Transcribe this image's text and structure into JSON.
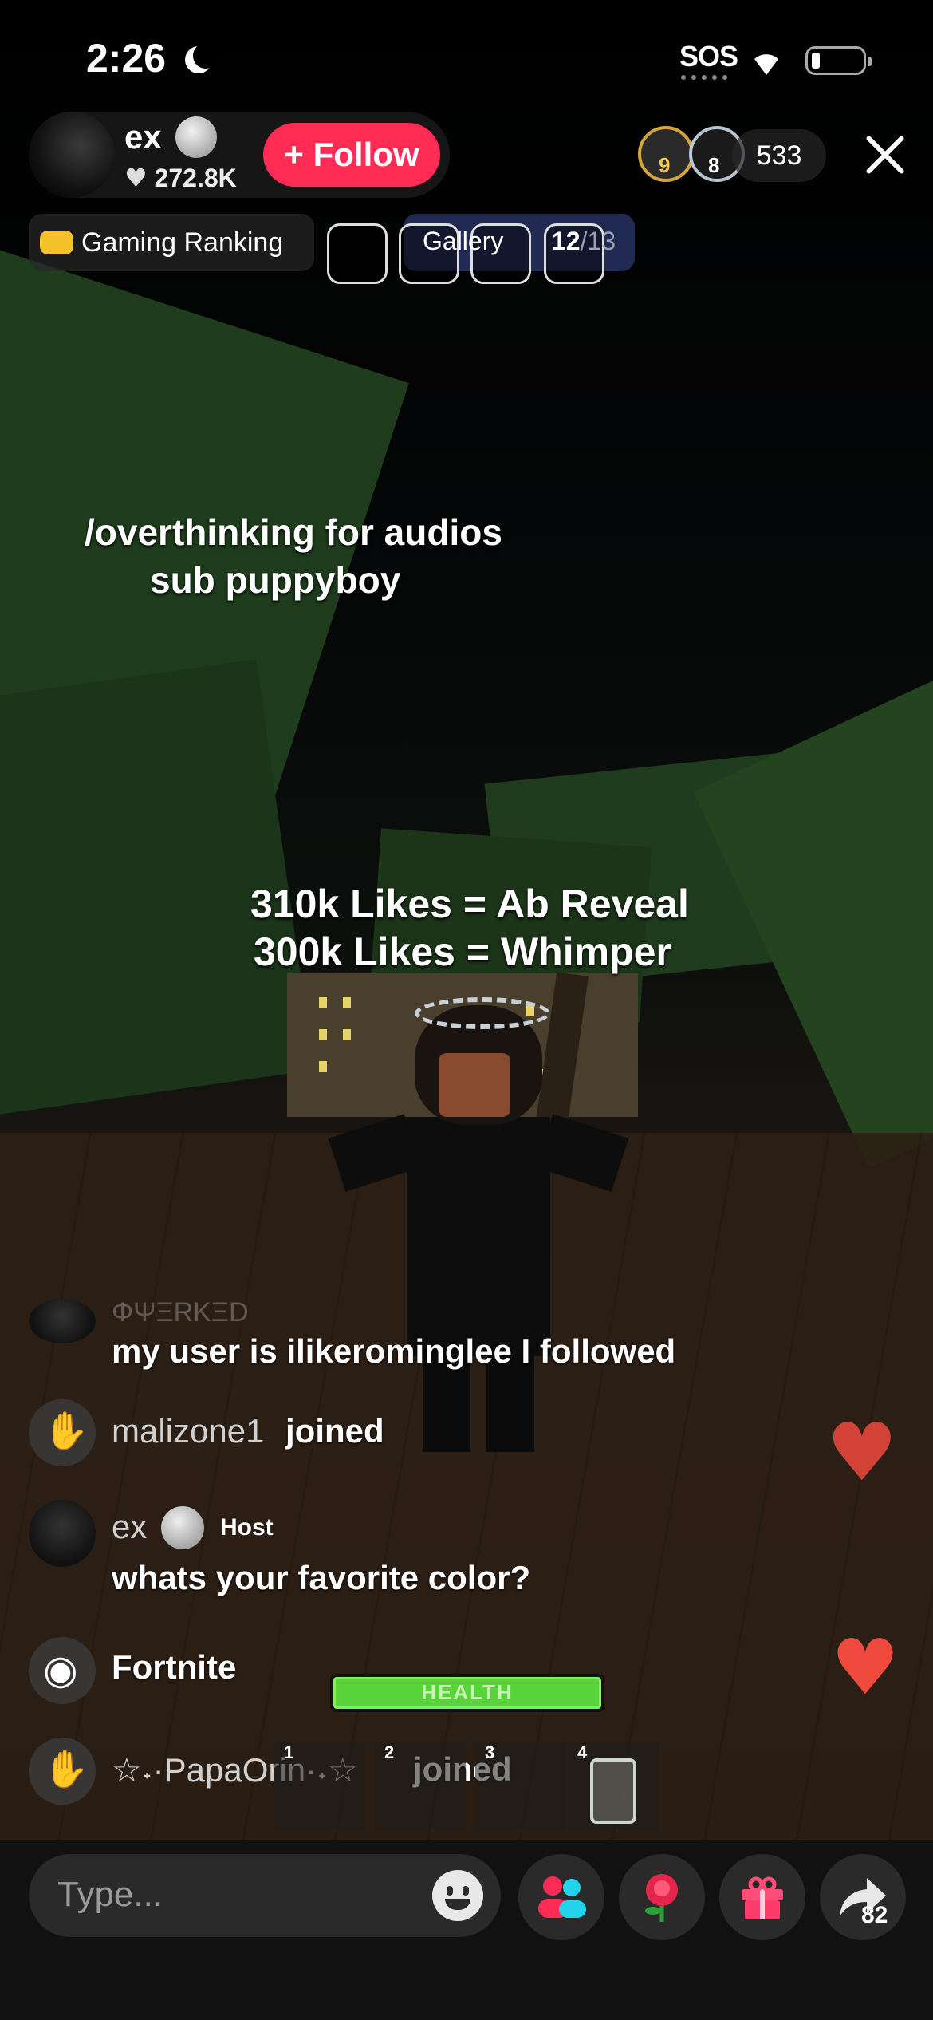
{
  "status_bar": {
    "time": "2:26",
    "sos": "SOS"
  },
  "host": {
    "name": "ex",
    "likes": "272.8K",
    "follow_label": "+ Follow"
  },
  "viewers": {
    "badge1_rank": "9",
    "badge2_rank": "8",
    "count": "533"
  },
  "top_row": {
    "ranking_label": "Gaming Ranking",
    "gallery_label": "Gallery",
    "gallery_current": "12",
    "gallery_total": "/13"
  },
  "stream_overlay": {
    "line1": "/overthinking for audios",
    "line2": "sub puppyboy",
    "line3": "310k Likes = Ab Reveal",
    "line4": "300k Likes = Whimper"
  },
  "comments": {
    "faded_name": "ΦΨΞRΚΞD",
    "c1_text": "my user is ilikerominglee I followed",
    "c2_name": "malizone1",
    "c2_text": "joined",
    "c3_name": "ex",
    "c3_tag": "Host",
    "c3_text": "whats your favorite color?",
    "c4_text": "Fortnite",
    "c5_name": "☆˖·PapaOrin·˖☆",
    "c5_text": "joined"
  },
  "game_hud": {
    "health_label": "HEALTH",
    "slots": [
      "1",
      "2",
      "3",
      "4"
    ]
  },
  "bottom": {
    "type_placeholder": "Type...",
    "share_count": "82"
  },
  "colors": {
    "follow": "#fe2c55",
    "heart": "#f0493d",
    "health": "#58d33a"
  }
}
